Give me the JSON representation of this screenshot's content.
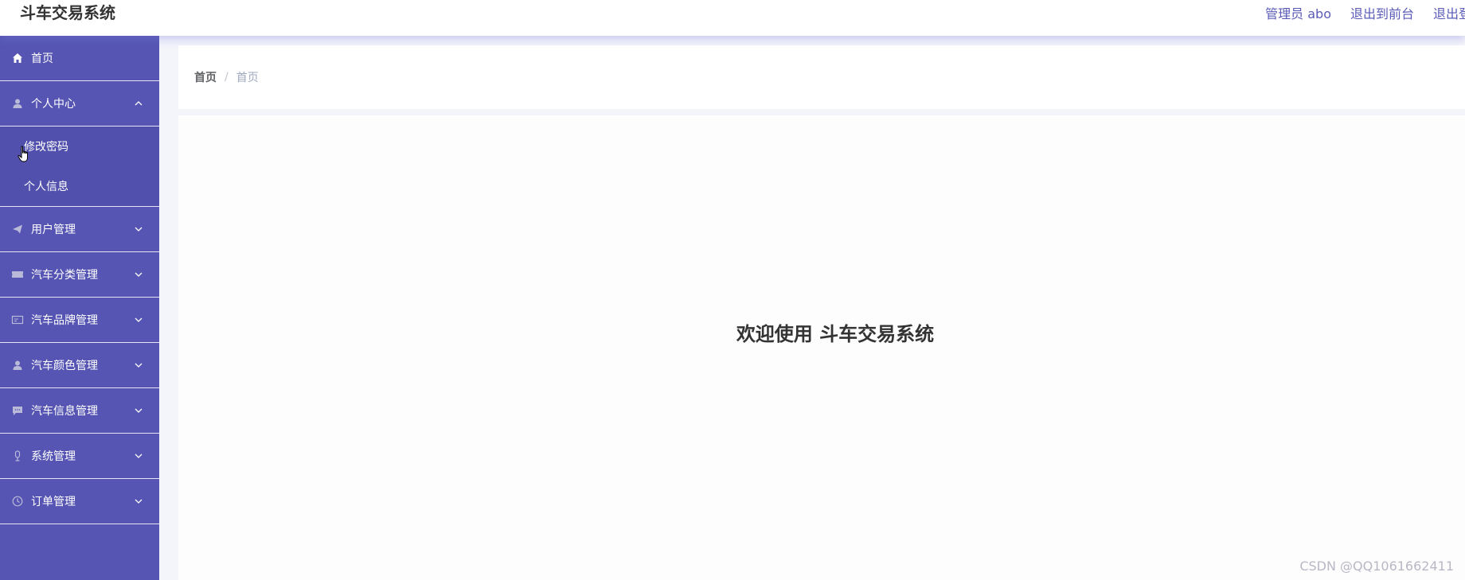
{
  "header": {
    "title": "斗车交易系统",
    "admin_label": "管理员 abo",
    "exit_front_label": "退出到前台",
    "logout_label": "退出登录"
  },
  "sidebar": {
    "items": [
      {
        "label": "首页",
        "icon": "home-icon"
      },
      {
        "label": "个人中心",
        "icon": "user-icon",
        "expanded": true,
        "children": [
          {
            "label": "修改密码"
          },
          {
            "label": "个人信息"
          }
        ]
      },
      {
        "label": "用户管理",
        "icon": "send-icon"
      },
      {
        "label": "汽车分类管理",
        "icon": "ticket-icon"
      },
      {
        "label": "汽车品牌管理",
        "icon": "card-icon"
      },
      {
        "label": "汽车颜色管理",
        "icon": "user-icon"
      },
      {
        "label": "汽车信息管理",
        "icon": "chat-icon"
      },
      {
        "label": "系统管理",
        "icon": "mic-icon"
      },
      {
        "label": "订单管理",
        "icon": "clock-icon"
      }
    ]
  },
  "breadcrumb": {
    "home": "首页",
    "separator": "/",
    "current": "首页"
  },
  "main": {
    "welcome": "欢迎使用 斗车交易系统"
  },
  "watermark": "CSDN @QQ1061662411",
  "colors": {
    "sidebar_bg": "#5655b3",
    "accent": "#5a5ab8",
    "text_dark": "#333333"
  }
}
